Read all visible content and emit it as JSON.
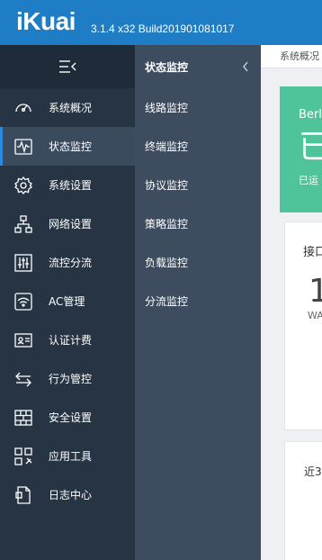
{
  "header": {
    "logo": "iKuai",
    "version": "3.1.4 x32 Build201901081017"
  },
  "sidebar": {
    "items": [
      {
        "label": "系统概况",
        "icon": "gauge-icon"
      },
      {
        "label": "状态监控",
        "icon": "pulse-monitor-icon",
        "active": true
      },
      {
        "label": "系统设置",
        "icon": "gear-icon"
      },
      {
        "label": "网络设置",
        "icon": "network-icon"
      },
      {
        "label": "流控分流",
        "icon": "sliders-icon"
      },
      {
        "label": "AC管理",
        "icon": "wifi-icon"
      },
      {
        "label": "认证计费",
        "icon": "id-card-icon"
      },
      {
        "label": "行为管控",
        "icon": "swap-arrows-icon"
      },
      {
        "label": "安全设置",
        "icon": "firewall-icon"
      },
      {
        "label": "应用工具",
        "icon": "apps-tool-icon"
      },
      {
        "label": "日志中心",
        "icon": "document-icon"
      }
    ]
  },
  "submenu": {
    "title": "状态监控",
    "items": [
      "线路监控",
      "终端监控",
      "协议监控",
      "策略监控",
      "负载监控",
      "分流监控"
    ]
  },
  "content": {
    "breadcrumb": "系统概况",
    "status_card": {
      "name": "Berl",
      "big": "已",
      "sub": "已运"
    },
    "card1": {
      "title": "接口",
      "number": "1",
      "label": "WA"
    },
    "card2": {
      "title": "近3"
    }
  },
  "colors": {
    "header": "#1f7dc6",
    "sidebar": "#263444",
    "submenu": "#3d4c5e",
    "accent": "#2a8ae0",
    "status_green": "#4fc49a"
  }
}
